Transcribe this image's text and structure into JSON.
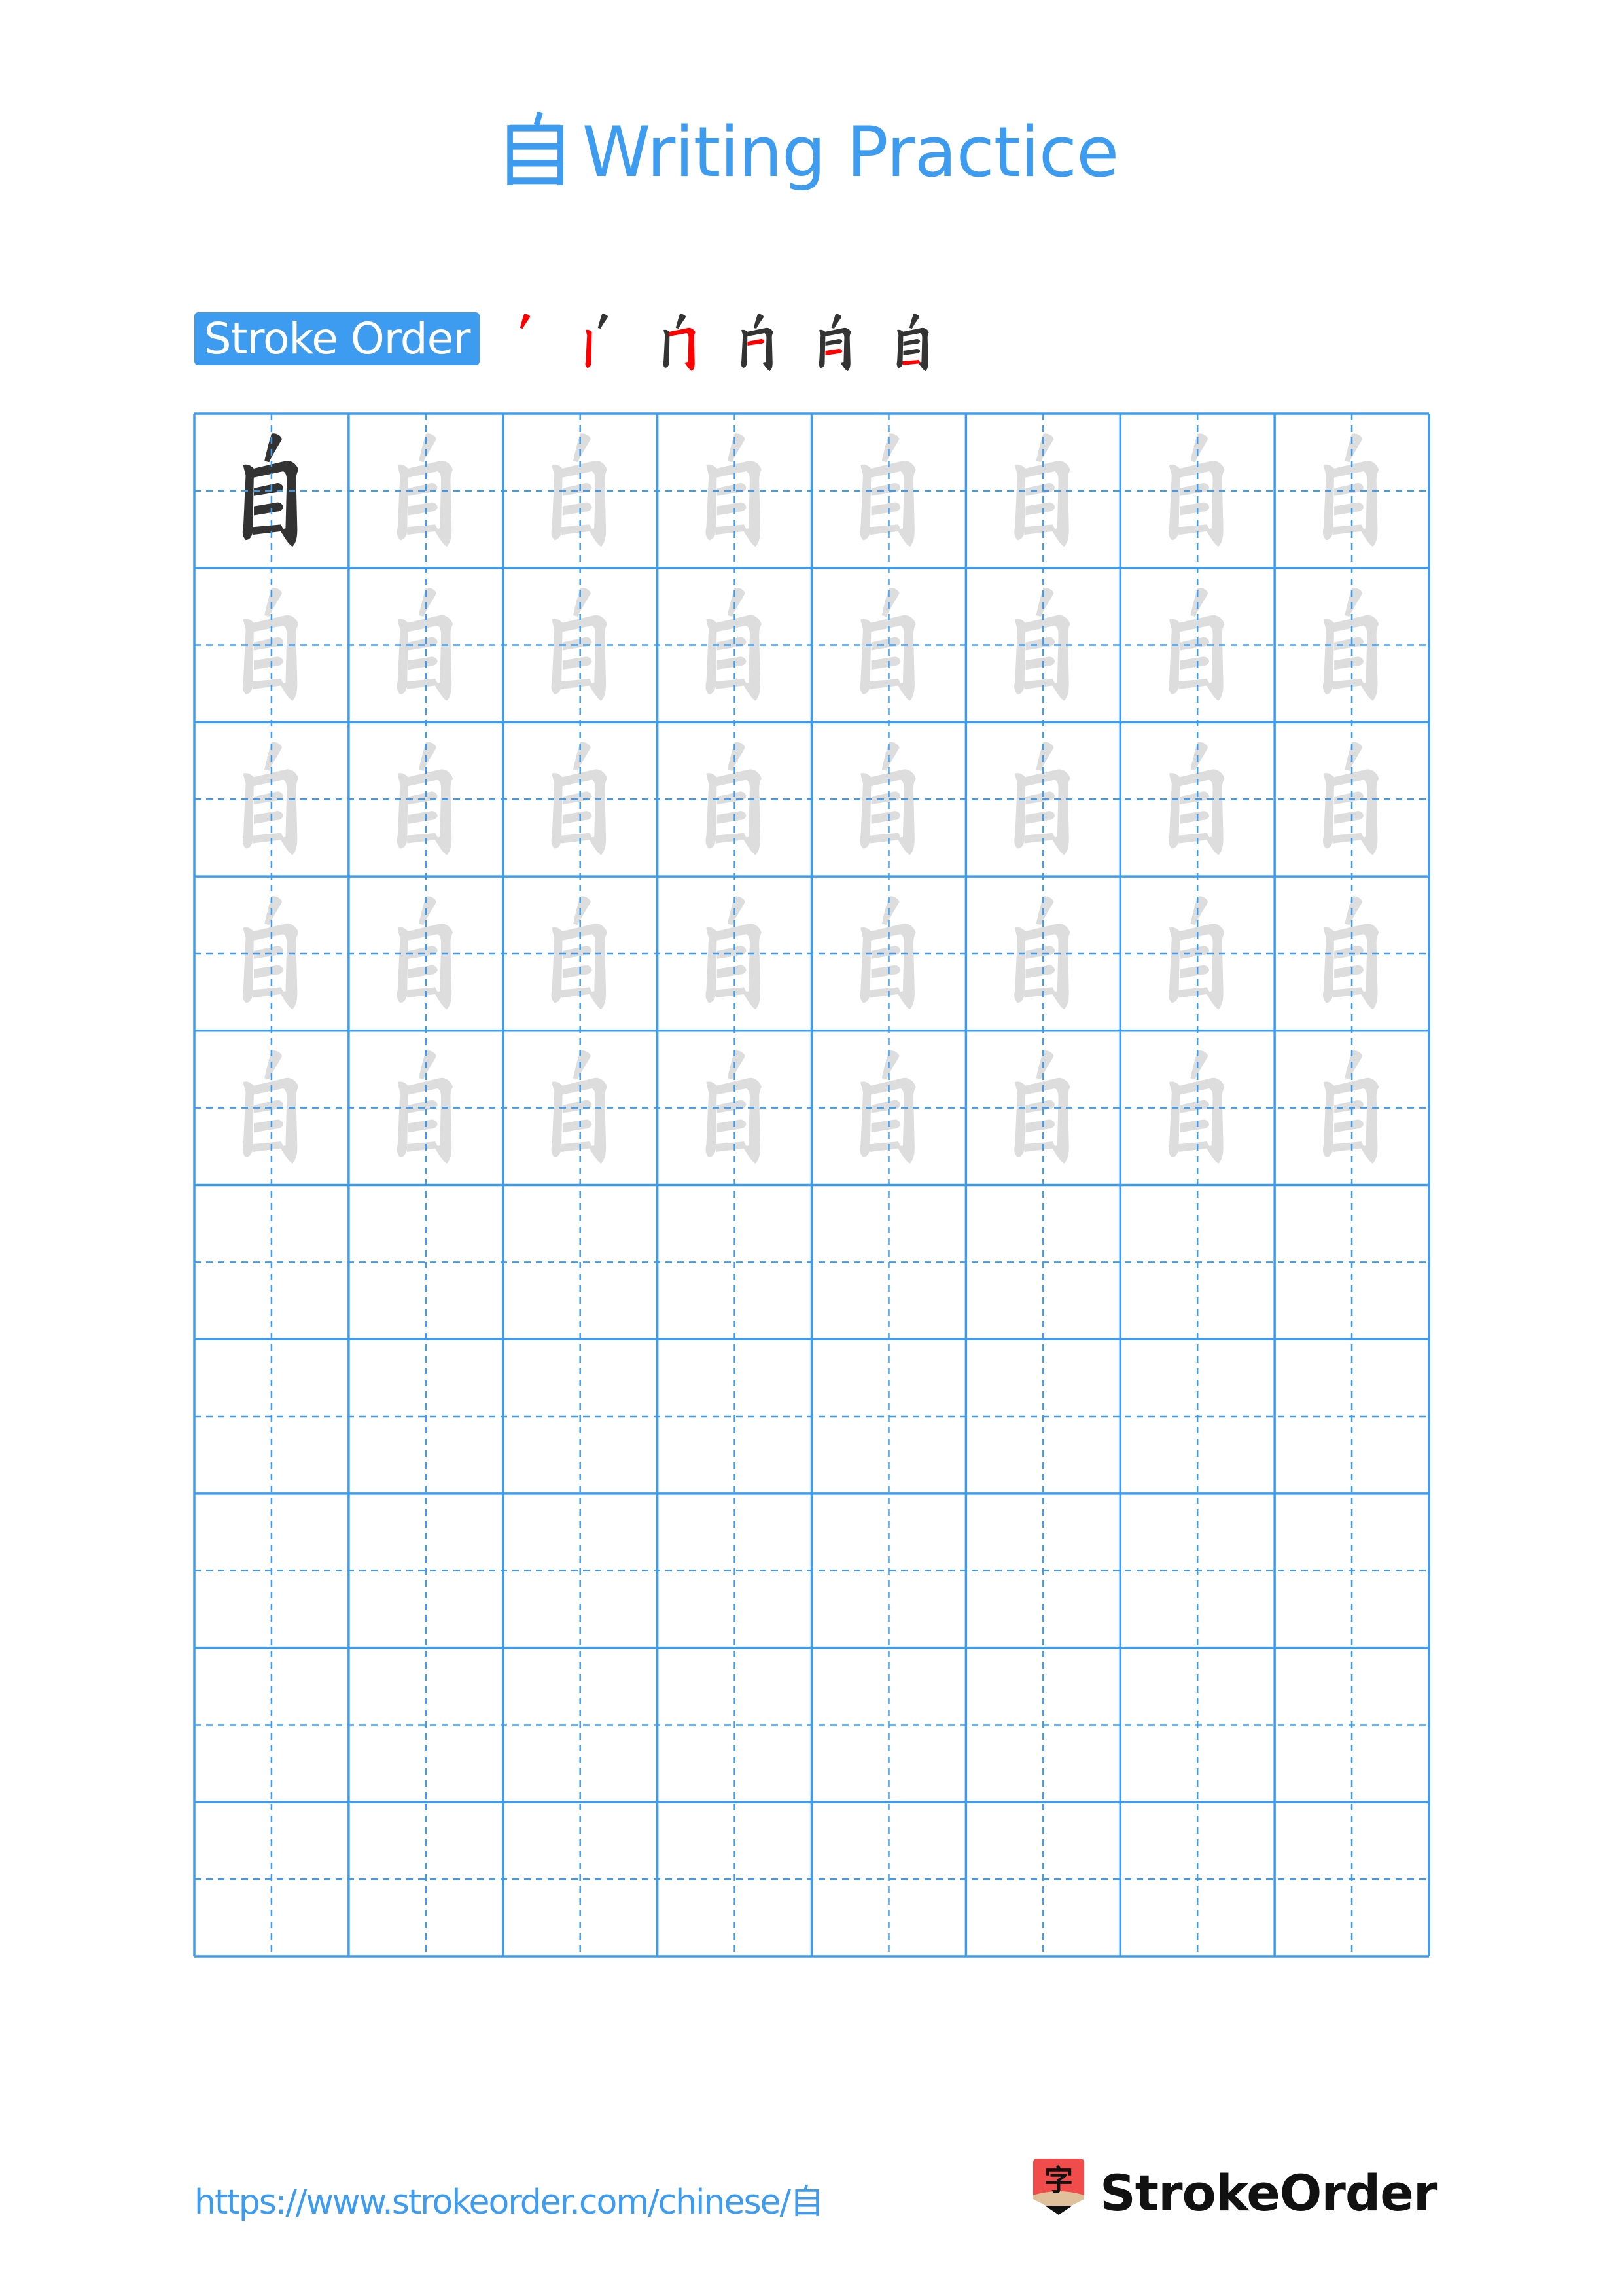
{
  "page": {
    "title_character": "自",
    "title_text": "Writing Practice",
    "colors": {
      "accent": "#3d9cf0",
      "stroke_highlight": "#ff0000",
      "stroke_done": "#333333",
      "model_character": "#333333",
      "trace_character": "#dddddd",
      "grid_line": "#3d9cf0",
      "logo_red": "#f04c4c",
      "logo_wood": "#e0c09a"
    }
  },
  "stroke_order": {
    "label": "Stroke Order",
    "total_strokes": 6,
    "steps": [
      {
        "step": 1,
        "completed_strokes": 0,
        "highlight_stroke": 1
      },
      {
        "step": 2,
        "completed_strokes": 1,
        "highlight_stroke": 2
      },
      {
        "step": 3,
        "completed_strokes": 2,
        "highlight_stroke": 3
      },
      {
        "step": 4,
        "completed_strokes": 3,
        "highlight_stroke": 4
      },
      {
        "step": 5,
        "completed_strokes": 4,
        "highlight_stroke": 5
      },
      {
        "step": 6,
        "completed_strokes": 5,
        "highlight_stroke": 6
      }
    ]
  },
  "practice_grid": {
    "columns": 8,
    "rows": 10,
    "character": "自",
    "model_cells": 1,
    "trace_rows": 5,
    "blank_rows": 5,
    "guide_lines": "dashed center cross"
  },
  "footer": {
    "url": "https://www.strokeorder.com/chinese/自",
    "brand_name": "StrokeOrder",
    "logo_glyph": "字"
  }
}
